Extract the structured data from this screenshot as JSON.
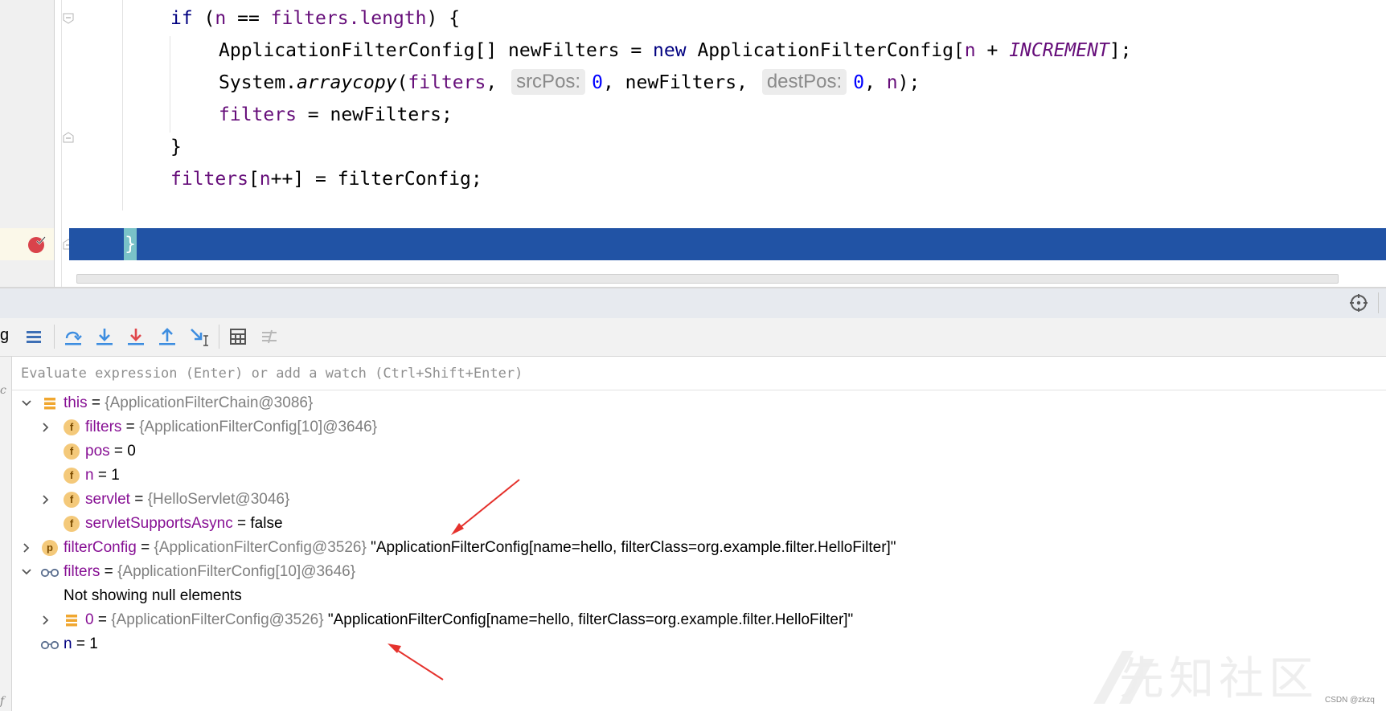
{
  "editor": {
    "hints": {
      "src_pos": "srcPos:",
      "dest_pos": "destPos:"
    },
    "lines": {
      "l1": {
        "kw_if": "if",
        "p1": " (",
        "n": "n",
        "p2": " == ",
        "filters": "filters",
        "dot_length": ".length",
        "p3": ") {"
      },
      "l2": {
        "p1": "ApplicationFilterConfig[] newFilters = ",
        "kw_new": "new",
        "p2": " ApplicationFilterConfig[",
        "n": "n",
        "p3": " + ",
        "increment": "INCREMENT",
        "p4": "];"
      },
      "l3": {
        "system": "System.",
        "arraycopy": "arraycopy",
        "p1": "(",
        "filters": "filters",
        "p2": ", ",
        "zero1": "0",
        "p3": ", newFilters, ",
        "zero2": "0",
        "p4": ", ",
        "n": "n",
        "p5": ");"
      },
      "l4": {
        "filters": "filters",
        "p1": " = newFilters;"
      },
      "l5": {
        "brace": "}"
      },
      "l6": {
        "filters": "filters",
        "p1": "[",
        "n": "n",
        "p2": "++] = filterConfig;"
      },
      "l7": {
        "brace": "}"
      }
    }
  },
  "toolbar": {
    "cut_label": "g"
  },
  "watch": {
    "placeholder": "Evaluate expression (Enter) or add a watch (Ctrl+Shift+Enter)"
  },
  "variables": [
    {
      "name": "this",
      "eq": " = ",
      "type": "{ApplicationFilterChain@3086}",
      "value": ""
    },
    {
      "name": "filters",
      "eq": " = ",
      "type": "{ApplicationFilterConfig[10]@3646}",
      "value": ""
    },
    {
      "name": "pos",
      "eq": " = ",
      "type": "",
      "value": "0"
    },
    {
      "name": "n",
      "eq": " = ",
      "type": "",
      "value": "1"
    },
    {
      "name": "servlet",
      "eq": " = ",
      "type": "{HelloServlet@3046}",
      "value": ""
    },
    {
      "name": "servletSupportsAsync",
      "eq": " = ",
      "type": "",
      "value": "false"
    },
    {
      "name": "filterConfig",
      "eq": " = ",
      "type": "{ApplicationFilterConfig@3526}",
      "value": " \"ApplicationFilterConfig[name=hello, filterClass=org.example.filter.HelloFilter]\""
    },
    {
      "name": "filters",
      "eq": " = ",
      "type": "{ApplicationFilterConfig[10]@3646}",
      "value": ""
    },
    {
      "name": "",
      "eq": "",
      "type": "",
      "value": "Not showing null elements"
    },
    {
      "name": "0",
      "eq": " = ",
      "type": "{ApplicationFilterConfig@3526}",
      "value": " \"ApplicationFilterConfig[name=hello, filterClass=org.example.filter.HelloFilter]\""
    },
    {
      "name": "n",
      "eq": " = ",
      "type": "",
      "value": "1"
    }
  ],
  "icons": {
    "field": "f",
    "param": "p",
    "watch": "glasses-icon",
    "object": "object-stack-icon"
  },
  "watermark": {
    "text": "先知社区",
    "source": "CSDN @zkzq"
  },
  "colors": {
    "exec_line": "#2153a5",
    "keyword": "#000080",
    "field": "#660e7a",
    "number": "#0000ff",
    "var_name": "#871094",
    "type_gray": "#7f7f7f",
    "arrow": "#e5322d"
  }
}
